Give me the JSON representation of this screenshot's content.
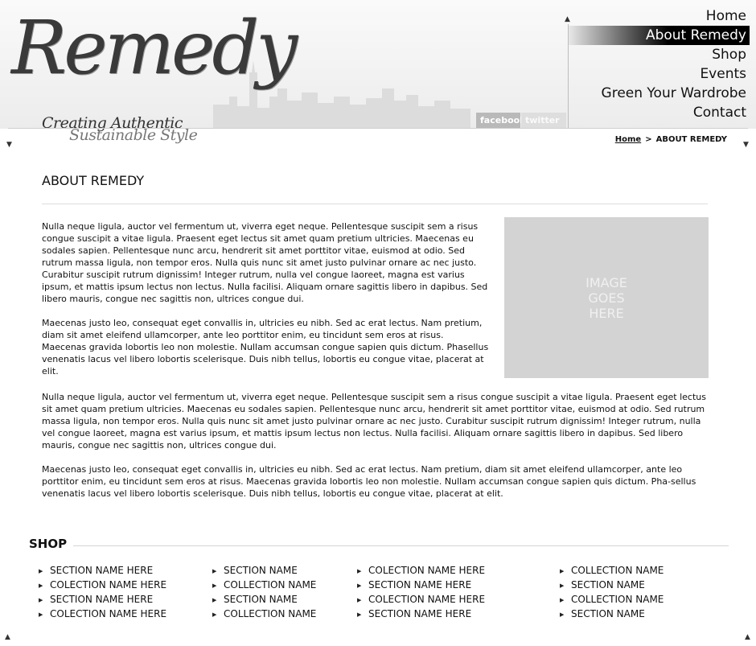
{
  "header": {
    "logo_text": "Remedy",
    "tagline_line1": "Creating Authentic",
    "tagline_line2": "Sustainable Style",
    "social": {
      "facebook": "facebook",
      "twitter": "twitter"
    }
  },
  "nav": {
    "items": [
      {
        "label": "Home",
        "active": false
      },
      {
        "label": "About Remedy",
        "active": true
      },
      {
        "label": "Shop",
        "active": false
      },
      {
        "label": "Events",
        "active": false
      },
      {
        "label": "Green Your Wardrobe",
        "active": false
      },
      {
        "label": "Contact",
        "active": false
      }
    ]
  },
  "breadcrumb": {
    "home": "Home",
    "separator": ">",
    "current": "ABOUT REMEDY"
  },
  "main": {
    "title": "ABOUT REMEDY",
    "image_placeholder": "IMAGE GOES HERE",
    "column_paragraphs": [
      "Nulla neque ligula, auctor vel fermentum ut, viverra eget neque. Pellentesque suscipit sem a risus congue suscipit a vitae ligula. Praesent eget lectus sit amet quam pretium ultricies. Maecenas eu sodales sapien. Pellentesque nunc arcu, hendrerit sit amet porttitor vitae, euismod at odio. Sed rutrum massa ligula, non tempor eros. Nulla quis nunc sit amet justo pulvinar ornare ac nec justo. Curabitur suscipit rutrum dignissim! Integer rutrum, nulla vel congue laoreet, magna est varius ipsum, et mattis ipsum lectus non lectus. Nulla facilisi. Aliquam ornare sagittis libero in dapibus. Sed libero mauris, congue nec sagittis non, ultrices congue dui.",
      "Maecenas justo leo, consequat eget convallis in, ultricies eu nibh. Sed ac erat lectus. Nam pretium, diam sit amet eleifend ullamcorper, ante leo porttitor enim, eu tincidunt sem eros at risus. Maecenas gravida lobortis leo non molestie. Nullam accumsan congue sapien quis dictum. Phasellus venenatis lacus vel libero lobortis scelerisque. Duis nibh tellus, lobortis eu congue vitae, placerat at elit."
    ],
    "full_paragraphs": [
      "Nulla neque ligula, auctor vel fermentum ut, viverra eget neque. Pellentesque suscipit sem a risus congue suscipit a vitae ligula. Praesent eget lectus sit amet quam pretium ultricies. Maecenas eu sodales sapien. Pellentesque nunc arcu, hendrerit sit amet porttitor vitae, euismod at odio. Sed rutrum massa ligula, non tempor eros. Nulla quis nunc sit amet justo pulvinar ornare ac nec justo. Curabitur suscipit rutrum dignissim! Integer rutrum, nulla vel congue laoreet, magna est varius ipsum, et mattis ipsum lectus non lectus. Nulla facilisi. Aliquam ornare sagittis libero in dapibus. Sed libero mauris, congue nec sagittis non, ultrices congue dui.",
      "Maecenas justo leo, consequat eget convallis in, ultricies eu nibh. Sed ac erat lectus. Nam pretium, diam sit amet eleifend ullamcorper, ante leo porttitor enim, eu tincidunt sem eros at risus. Maecenas gravida lobortis leo non molestie. Nullam accumsan congue sapien quis dictum. Pha-sellus venenatis lacus vel libero lobortis scelerisque. Duis nibh tellus, lobortis eu congue vitae, placerat at elit."
    ]
  },
  "shop": {
    "title": "SHOP",
    "columns": [
      [
        "SECTION NAME HERE",
        "COLECTION NAME HERE",
        "SECTION NAME HERE",
        "COLECTION NAME HERE"
      ],
      [
        "SECTION NAME",
        "COLLECTION NAME",
        "SECTION NAME",
        "COLLECTION NAME"
      ],
      [
        "COLECTION NAME HERE",
        "SECTION NAME HERE",
        "COLECTION NAME HERE",
        "SECTION NAME HERE"
      ],
      [
        "COLLECTION NAME",
        "SECTION NAME",
        "COLLECTION NAME",
        "SECTION NAME"
      ]
    ]
  },
  "colors": {
    "image_placeholder_bg": "#d3d3d3",
    "nav_active_bg": "#000000",
    "text": "#111111"
  }
}
